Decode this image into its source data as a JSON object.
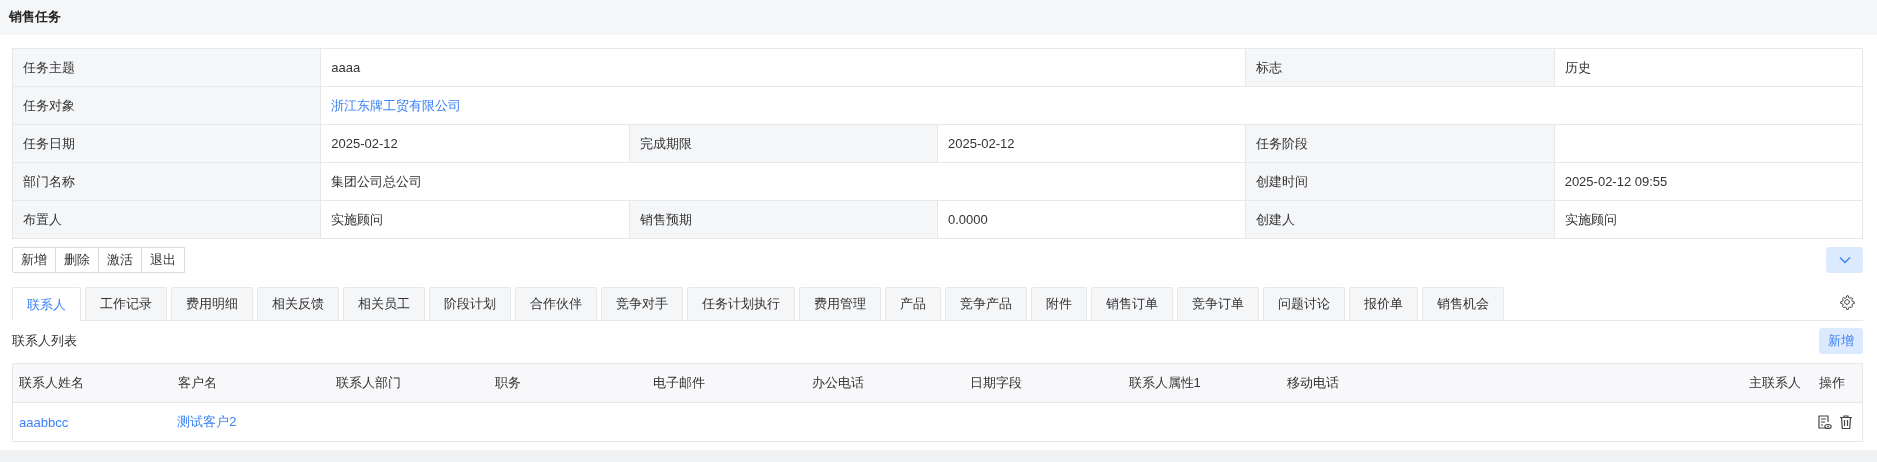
{
  "page": {
    "title": "销售任务"
  },
  "info": {
    "rows": [
      [
        {
          "kind": "label",
          "text": "任务主题"
        },
        {
          "kind": "value",
          "text": "aaaa"
        },
        {
          "kind": "label",
          "text": "标志"
        },
        {
          "kind": "value",
          "text": "历史"
        }
      ],
      [
        {
          "kind": "label",
          "text": "任务对象"
        },
        {
          "kind": "link",
          "text": "浙江东牌工贸有限公司"
        }
      ],
      [
        {
          "kind": "label",
          "text": "任务日期"
        },
        {
          "kind": "value",
          "text": "2025-02-12"
        },
        {
          "kind": "label",
          "text": "完成期限"
        },
        {
          "kind": "value",
          "text": "2025-02-12"
        },
        {
          "kind": "label",
          "text": "任务阶段"
        },
        {
          "kind": "value"
        }
      ],
      [
        {
          "kind": "label",
          "text": "部门名称"
        },
        {
          "kind": "value",
          "text": "集团公司总公司"
        },
        {
          "kind": "label",
          "text": "创建时间"
        },
        {
          "kind": "value",
          "text": "2025-02-12 09:55"
        }
      ],
      [
        {
          "kind": "label",
          "text": "布置人"
        },
        {
          "kind": "value",
          "text": "实施顾问"
        },
        {
          "kind": "label",
          "text": "销售预期"
        },
        {
          "kind": "value",
          "text": "0.0000"
        },
        {
          "kind": "label",
          "text": "创建人"
        },
        {
          "kind": "value",
          "text": "实施顾问"
        }
      ]
    ]
  },
  "actions": [
    "新增",
    "删除",
    "激活",
    "退出"
  ],
  "tabs": [
    {
      "label": "联系人",
      "selected": true
    },
    {
      "label": "工作记录",
      "selected": false
    },
    {
      "label": "费用明细",
      "selected": false
    },
    {
      "label": "相关反馈",
      "selected": false
    },
    {
      "label": "相关员工",
      "selected": false
    },
    {
      "label": "阶段计划",
      "selected": false
    },
    {
      "label": "合作伙伴",
      "selected": false
    },
    {
      "label": "竞争对手",
      "selected": false
    },
    {
      "label": "任务计划执行",
      "selected": false
    },
    {
      "label": "费用管理",
      "selected": false
    },
    {
      "label": "产品",
      "selected": false
    },
    {
      "label": "竞争产品",
      "selected": false
    },
    {
      "label": "附件",
      "selected": false
    },
    {
      "label": "销售订单",
      "selected": false
    },
    {
      "label": "竞争订单",
      "selected": false
    },
    {
      "label": "问题讨论",
      "selected": false
    },
    {
      "label": "报价单",
      "selected": false
    },
    {
      "label": "销售机会",
      "selected": false
    }
  ],
  "list": {
    "title": "联系人列表",
    "add_button": "新增",
    "columns": [
      "联系人姓名",
      "客户名",
      "联系人部门",
      "职务",
      "电子邮件",
      "办公电话",
      "日期字段",
      "联系人属性1",
      "移动电话",
      "主联系人",
      "操作"
    ],
    "rows": [
      {
        "name": "aaabbcc",
        "customer": "测试客户2"
      }
    ]
  }
}
